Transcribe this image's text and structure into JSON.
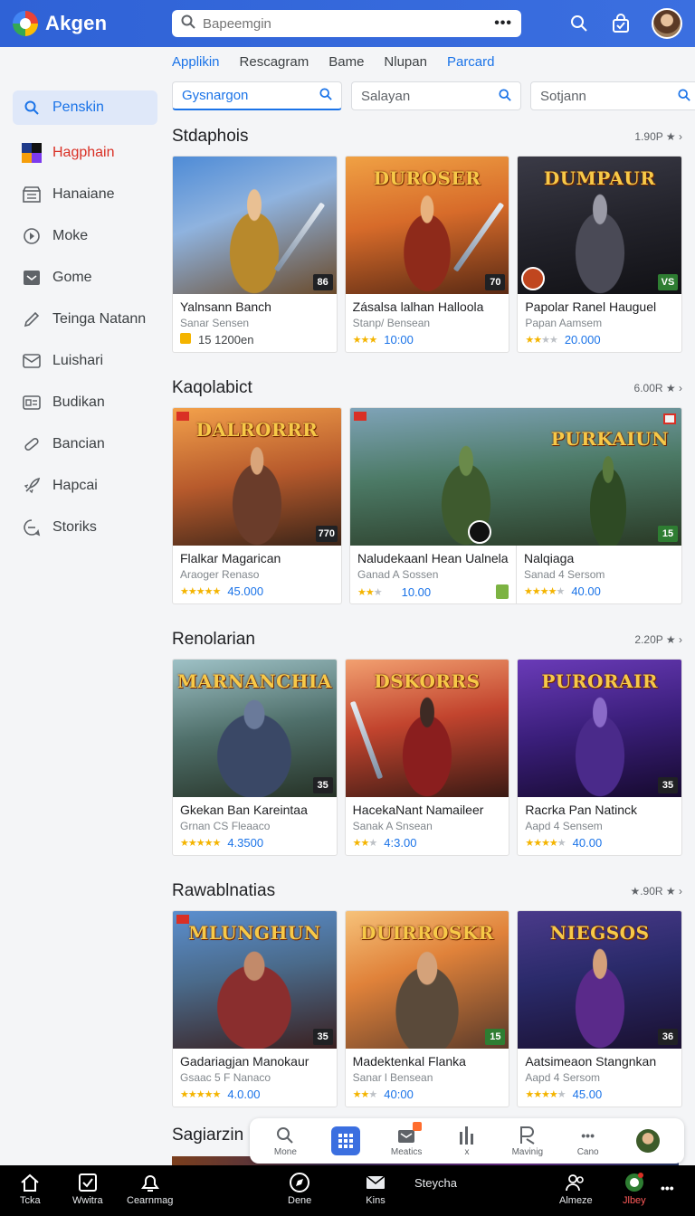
{
  "app": {
    "name": "Akgen"
  },
  "search": {
    "placeholder": "Bapeemgin"
  },
  "tabs": [
    {
      "label": "Applikin",
      "active": true
    },
    {
      "label": "Rescagram"
    },
    {
      "label": "Bame"
    },
    {
      "label": "Nlupan"
    },
    {
      "label": "Parcard"
    }
  ],
  "filters": [
    {
      "label": "Gysnargon"
    },
    {
      "label": "Salayan"
    },
    {
      "label": "Sotjann"
    }
  ],
  "sidebar": {
    "items": [
      {
        "label": "Penskin",
        "icon": "search-icon"
      },
      {
        "label": "Hagphain",
        "icon": "app-logo-icon"
      },
      {
        "label": "Hanaiane",
        "icon": "store-icon"
      },
      {
        "label": "Moke",
        "icon": "clock-icon"
      },
      {
        "label": "Gome",
        "icon": "inbox-icon"
      },
      {
        "label": "Teinga Natann",
        "icon": "pencil-icon"
      },
      {
        "label": "Luishari",
        "icon": "mail-icon"
      },
      {
        "label": "Budikan",
        "icon": "card-icon"
      },
      {
        "label": "Bancian",
        "icon": "link-icon"
      },
      {
        "label": "Hapcai",
        "icon": "rocket-icon"
      },
      {
        "label": "Storiks",
        "icon": "chat-icon"
      }
    ]
  },
  "sections": [
    {
      "title": "Stdaphois",
      "more": "1.90P ★ ›",
      "cards": [
        {
          "art": "",
          "badge": "86",
          "name": "Yalnsann Banch",
          "dev": "Sanar Sensen",
          "rating": "15 1200en",
          "stars": 1
        },
        {
          "art": "DUROSER",
          "badge": "70",
          "name": "Zásalsa lalhan Halloola",
          "dev": "Stanp/ Bensean",
          "rating": "10:00",
          "stars": 3
        },
        {
          "art": "DUMPAUR",
          "badge": "VS",
          "name": "Papolar Ranel Hauguel",
          "dev": "Papan Aamsem",
          "rating": "20.000",
          "stars": 2
        }
      ]
    },
    {
      "title": "Kaqolabict",
      "more": "6.00R ★ ›",
      "cards": [
        {
          "art": "DALRORRR",
          "badge": "770",
          "name": "Flalkar Magarican",
          "dev": "Araoger Renaso",
          "rating": "45.000",
          "stars": 5
        },
        {
          "art": "",
          "badge": "",
          "name": "Naludekaanl Hean Ualnela",
          "dev": "Ganad A Sossen",
          "rating": "10.00",
          "stars": 2
        },
        {
          "art": "PURKAIUN",
          "badge": "15",
          "name": "Nalqiaga",
          "dev": "Sanad 4 Sersom",
          "rating": "40.00",
          "stars": 4
        }
      ]
    },
    {
      "title": "Renolarian",
      "more": "2.20P ★ ›",
      "cards": [
        {
          "art": "MARNANCHIA",
          "badge": "35",
          "name": "Gkekan Ban Kareintaa",
          "dev": "Grnan CS Fleaaco",
          "rating": "4.3500",
          "stars": 5
        },
        {
          "art": "DSKORRS",
          "badge": "",
          "name": "HacekaNant Namaileer",
          "dev": "Sanak A Snsean",
          "rating": "4:3.00",
          "stars": 2
        },
        {
          "art": "PURORAIR",
          "badge": "35",
          "name": "Racrka Pan Natinck",
          "dev": "Aapd 4 Sensem",
          "rating": "40.00",
          "stars": 4
        }
      ]
    },
    {
      "title": "Rawablnatias",
      "more": "★.90R ★ ›",
      "cards": [
        {
          "art": "MLUNGHUN",
          "badge": "35",
          "name": "Gadariagjan Manokaur",
          "dev": "Gsaac 5 F Nanaco",
          "rating": "4.0.00",
          "stars": 5
        },
        {
          "art": "DUIRROSKR",
          "badge": "15",
          "name": "Madektenkal Flanka",
          "dev": "Sanar l Bensean",
          "rating": "40:00",
          "stars": 2
        },
        {
          "art": "NIEGSOS",
          "badge": "36",
          "name": "Aatsimeaon Stangnkan",
          "dev": "Aapd 4 Sersom",
          "rating": "45.00",
          "stars": 4
        }
      ]
    }
  ],
  "peek_title": "Sagiarzin",
  "dock": [
    {
      "label": "Mone",
      "icon": "search-icon"
    },
    {
      "label": "",
      "icon": "grid-icon",
      "active": true
    },
    {
      "label": "Meatics",
      "icon": "message-icon"
    },
    {
      "label": "x",
      "icon": "bars-icon"
    },
    {
      "label": "Mavinig",
      "icon": "pen-icon"
    },
    {
      "label": "Cano",
      "icon": "dots-icon"
    },
    {
      "label": "",
      "icon": "avatar-icon"
    }
  ],
  "taskbar": [
    {
      "label": "Tcka",
      "icon": "home-icon"
    },
    {
      "label": "Wwitra",
      "icon": "checkbox-icon"
    },
    {
      "label": "Cearnmag",
      "icon": "bell-icon"
    },
    {
      "label": "Dene",
      "icon": "compass-icon"
    },
    {
      "label": "Kins",
      "icon": "mail-icon"
    },
    {
      "label": "Steycha",
      "icon": ""
    },
    {
      "label": "Almeze",
      "icon": "people-icon"
    },
    {
      "label": "Jlbey",
      "icon": "game-icon"
    },
    {
      "label": "",
      "icon": "more-icon"
    }
  ],
  "colors": {
    "appbar": "#3b6fe0",
    "accent": "#1a73e8",
    "star": "#f4b400"
  }
}
